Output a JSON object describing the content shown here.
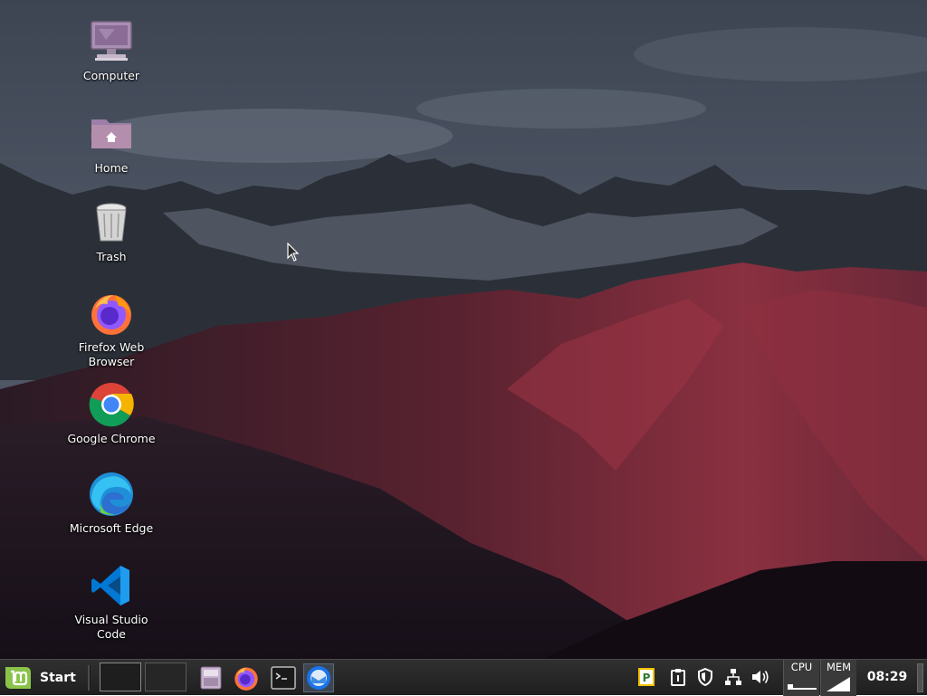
{
  "desktop": {
    "icons": [
      {
        "label": "Computer",
        "icon": "computer-icon"
      },
      {
        "label": "Home",
        "icon": "home-folder-icon"
      },
      {
        "label": "Trash",
        "icon": "trash-icon"
      },
      {
        "label": "Firefox Web Browser",
        "icon": "firefox-icon"
      },
      {
        "label": "Google Chrome",
        "icon": "chrome-icon"
      },
      {
        "label": "Microsoft Edge",
        "icon": "edge-icon"
      },
      {
        "label": "Visual Studio Code",
        "icon": "vscode-icon"
      }
    ]
  },
  "taskbar": {
    "start_label": "Start",
    "launchers": [
      "file-manager-icon",
      "firefox-icon",
      "terminal-icon",
      "thunderbird-icon"
    ],
    "tray": [
      "pamac-icon",
      "clipboard-icon",
      "shield-icon",
      "network-icon",
      "volume-icon"
    ],
    "cpu_label": "CPU",
    "mem_label": "MEM",
    "clock": "08:29"
  },
  "colors": {
    "taskbar": "#262626",
    "mint_green": "#8bc34a",
    "folder_purple": "#b48ead"
  }
}
